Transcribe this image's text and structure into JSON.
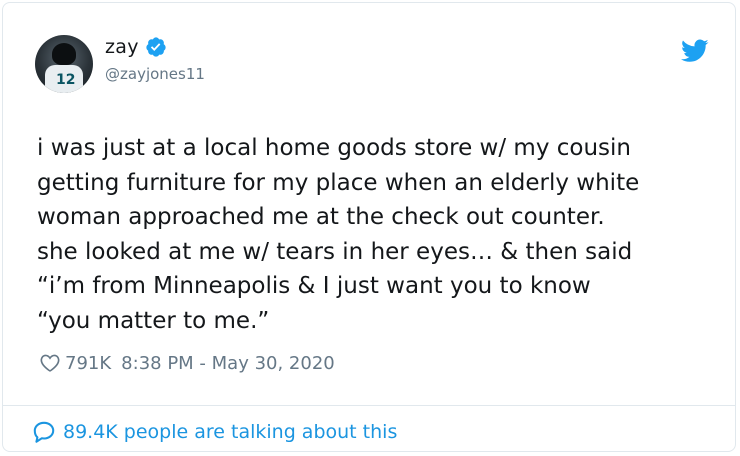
{
  "author": {
    "display_name": "zay",
    "handle": "@zayjones11",
    "avatar_jersey_number": "12",
    "verified": true
  },
  "tweet": {
    "text": "i was just at a local home goods store w/ my cousin\ngetting furniture for my place when an elderly white\nwoman approached me at the check out counter.\nshe looked at me w/ tears in her eyes… & then said\n“i’m from Minneapolis & I just want you to know\n“you matter to me.”",
    "likes": "791K",
    "timestamp": "8:38 PM - May 30, 2020"
  },
  "footer": {
    "talking_text": "89.4K people are talking about this"
  },
  "colors": {
    "accent": "#1b95e0",
    "twitter_blue": "#1da1f2",
    "secondary_text": "#657786",
    "border": "#e1e8ed"
  },
  "icons": {
    "verified": "verified-badge-icon",
    "brand": "twitter-bird-icon",
    "like": "heart-icon",
    "reply": "speech-bubble-icon"
  }
}
